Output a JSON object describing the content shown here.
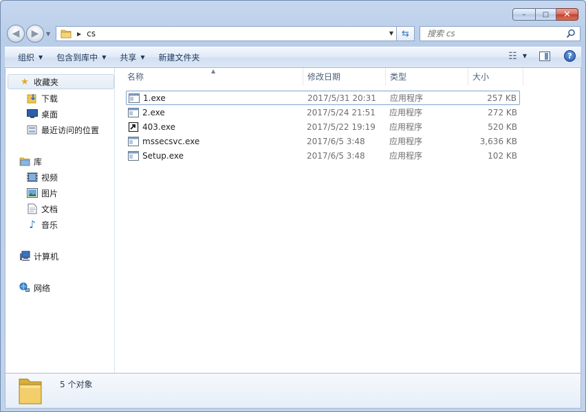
{
  "window": {
    "caption_buttons": {
      "minimize": "–",
      "maximize": "□",
      "close": "✕"
    }
  },
  "address": {
    "folder": "cs",
    "search_placeholder": "搜索 cs"
  },
  "toolbar": {
    "organize": "组织",
    "include_in_library": "包含到库中",
    "share": "共享",
    "new_folder": "新建文件夹",
    "help": "?"
  },
  "nav": {
    "favorites": "收藏夹",
    "downloads": "下载",
    "desktop": "桌面",
    "recent_places": "最近访问的位置",
    "libraries": "库",
    "videos": "视频",
    "pictures": "图片",
    "documents": "文档",
    "music": "音乐",
    "computer": "计算机",
    "network": "网络"
  },
  "columns": {
    "name": "名称",
    "date": "修改日期",
    "type": "类型",
    "size": "大小"
  },
  "files": [
    {
      "name": "1.exe",
      "date": "2017/5/31 20:31",
      "type": "应用程序",
      "size": "257 KB",
      "icon": "exe-window-icon"
    },
    {
      "name": "2.exe",
      "date": "2017/5/24 21:51",
      "type": "应用程序",
      "size": "272 KB",
      "icon": "exe-window-icon"
    },
    {
      "name": "403.exe",
      "date": "2017/5/22 19:19",
      "type": "应用程序",
      "size": "520 KB",
      "icon": "exe-custom-icon"
    },
    {
      "name": "mssecsvc.exe",
      "date": "2017/6/5 3:48",
      "type": "应用程序",
      "size": "3,636 KB",
      "icon": "exe-window-icon"
    },
    {
      "name": "Setup.exe",
      "date": "2017/6/5 3:48",
      "type": "应用程序",
      "size": "102 KB",
      "icon": "exe-window-icon"
    }
  ],
  "status": {
    "count": "5 个对象"
  }
}
